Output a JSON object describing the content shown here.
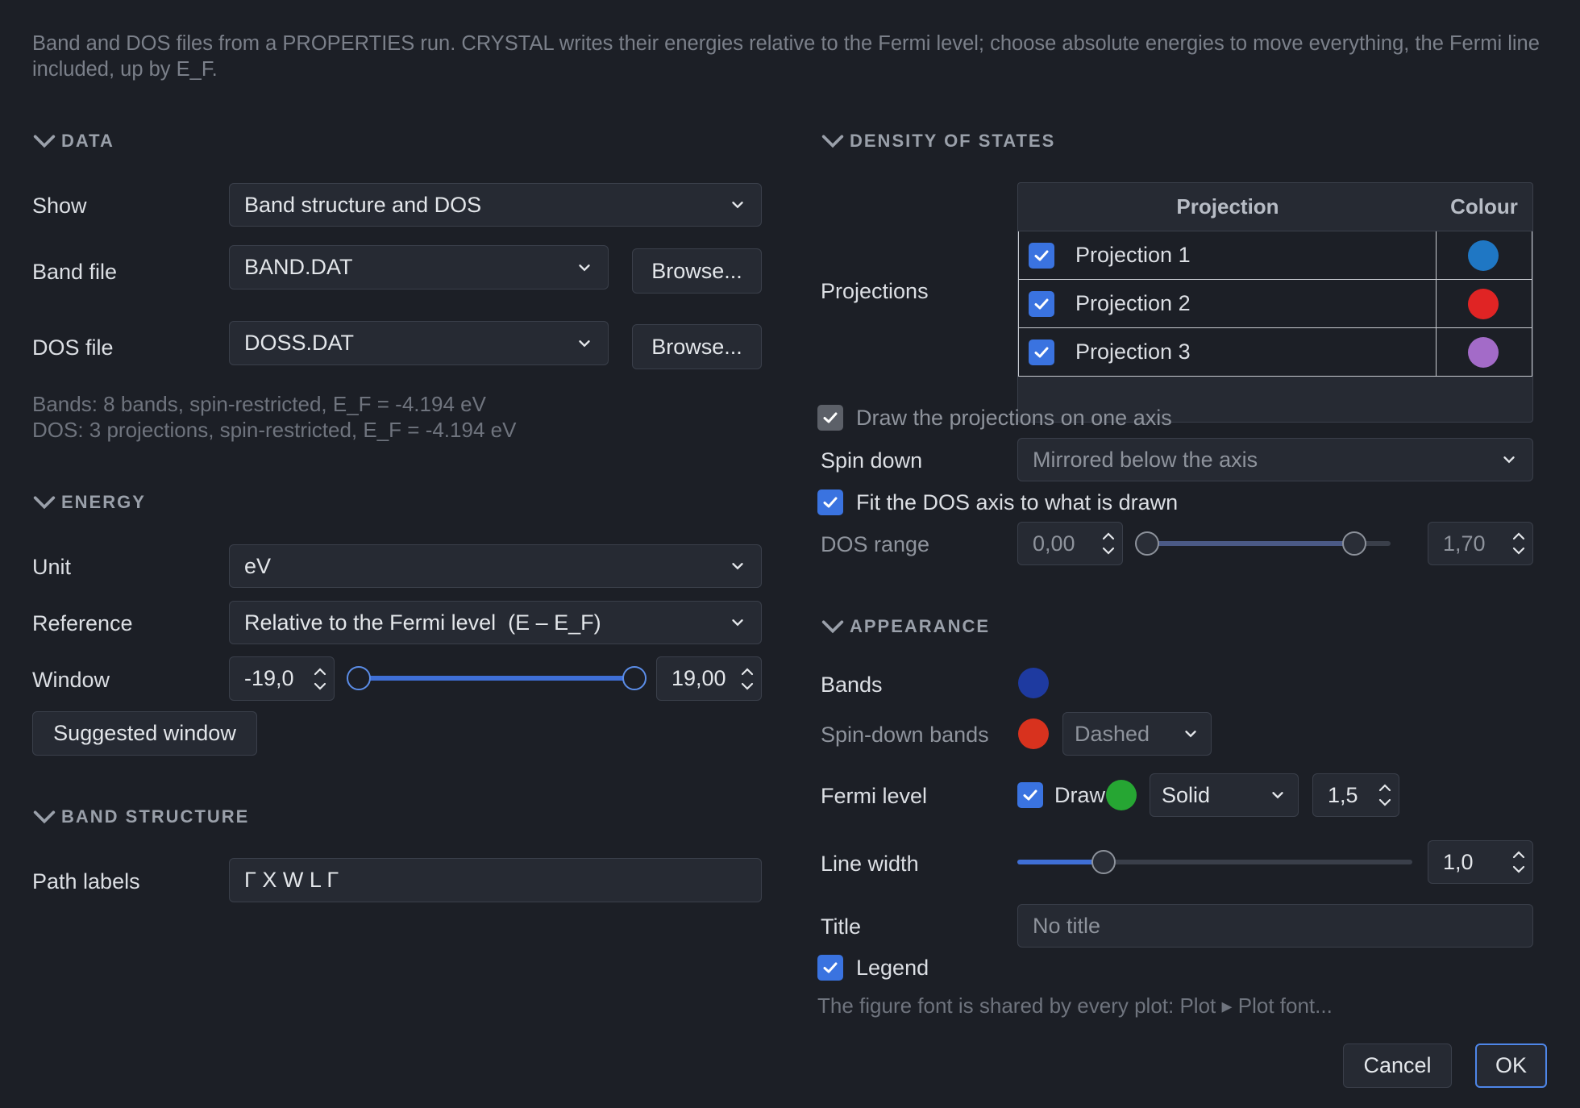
{
  "intro": "Band and DOS files from a PROPERTIES run. CRYSTAL writes their energies relative to the Fermi level; choose absolute energies to move everything, the Fermi line included, up by E_F.",
  "data_section": {
    "heading": "DATA",
    "show_label": "Show",
    "show_value": "Band structure and DOS",
    "band_file_label": "Band file",
    "band_file_value": "BAND.DAT",
    "band_browse": "Browse...",
    "dos_file_label": "DOS file",
    "dos_file_value": "DOSS.DAT",
    "dos_browse": "Browse...",
    "bands_info": "Bands: 8 bands, spin-restricted, E_F = -4.194 eV",
    "dos_info": "DOS: 3 projections, spin-restricted, E_F = -4.194 eV"
  },
  "energy_section": {
    "heading": "ENERGY",
    "unit_label": "Unit",
    "unit_value": "eV",
    "reference_label": "Reference",
    "reference_value": "Relative to the Fermi level  (E – E_F)",
    "window_label": "Window",
    "window_min": "-19,0",
    "window_max": "19,00",
    "window_range_fraction": [
      0.0,
      1.0
    ],
    "suggested_button": "Suggested window"
  },
  "band_structure_section": {
    "heading": "BAND STRUCTURE",
    "path_labels_label": "Path labels",
    "path_labels_value": "Γ X W L Γ"
  },
  "dos_section": {
    "heading": "DENSITY OF STATES",
    "projections_label": "Projections",
    "table_headers": {
      "projection": "Projection",
      "colour": "Colour"
    },
    "projections": [
      {
        "name": "Projection 1",
        "checked": true,
        "color": "#1f77c4"
      },
      {
        "name": "Projection 2",
        "checked": true,
        "color": "#e02424"
      },
      {
        "name": "Projection 3",
        "checked": true,
        "color": "#a36bc8"
      }
    ],
    "one_axis_label": "Draw the projections on one axis",
    "spin_down_label": "Spin down",
    "spin_down_value": "Mirrored below the axis",
    "fit_axis_label": "Fit the DOS axis to what is drawn",
    "dos_range_label": "DOS range",
    "dos_range_min": "0,00",
    "dos_range_max": "1,70",
    "dos_range_fraction": [
      0.0,
      0.85
    ]
  },
  "appearance_section": {
    "heading": "APPEARANCE",
    "bands_label": "Bands",
    "bands_color": "#1e3aa0",
    "spin_down_bands_label": "Spin-down bands",
    "spin_down_bands_color": "#d8321e",
    "spin_down_style": "Dashed",
    "fermi_label": "Fermi level",
    "fermi_draw_label": "Draw",
    "fermi_color": "#26a633",
    "fermi_style": "Solid",
    "fermi_width": "1,5",
    "line_width_label": "Line width",
    "line_width_value": "1,0",
    "line_width_fraction": 0.2,
    "title_label": "Title",
    "title_placeholder": "No title",
    "legend_label": "Legend",
    "font_note": "The figure font is shared by every plot: Plot ▸ Plot font..."
  },
  "footer": {
    "cancel": "Cancel",
    "ok": "OK"
  },
  "colors": {
    "accent": "#3a73e0",
    "background": "#1c1f26"
  }
}
